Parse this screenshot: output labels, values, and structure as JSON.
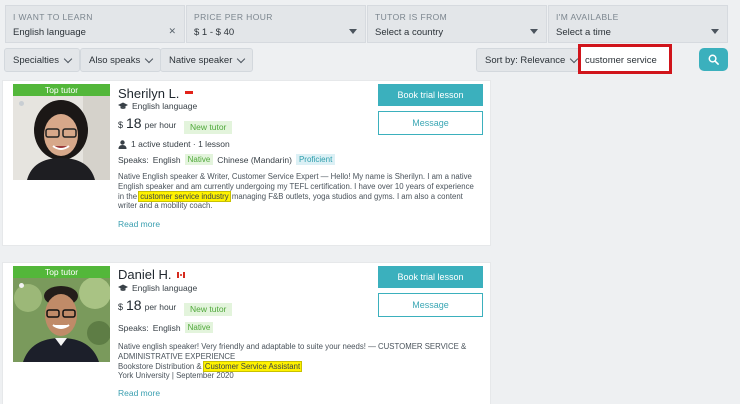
{
  "filters": {
    "learn": {
      "label": "I WANT TO LEARN",
      "value": "English language"
    },
    "price": {
      "label": "PRICE PER HOUR",
      "value": "$ 1 - $ 40"
    },
    "country": {
      "label": "TUTOR IS FROM",
      "value": "Select a country"
    },
    "available": {
      "label": "I'M AVAILABLE",
      "value": "Select a time"
    }
  },
  "chips": {
    "specialties": "Specialties",
    "also_speaks": "Also speaks",
    "native_speaker": "Native speaker"
  },
  "sort": {
    "label": "Sort by: Relevance"
  },
  "search": {
    "value": "customer service"
  },
  "colors": {
    "accent": "#3bb0bd",
    "top_tutor": "#53b73a",
    "highlight_border": "#d0141b",
    "highlight": "#fff200"
  },
  "tutors": [
    {
      "badge": "Top tutor",
      "name": "Sherilyn L.",
      "subject": "English language",
      "currency": "$",
      "price": "18",
      "per": "per hour",
      "new_tag": "New tutor",
      "activity": "1 active student · 1 lesson",
      "speaks_label": "Speaks:",
      "speaks_1": "English",
      "speaks_1_level": "Native",
      "speaks_2": "Chinese (Mandarin)",
      "speaks_2_level": "Proficient",
      "desc_a": "Native English speaker & Writer, Customer Service Expert — Hello! My name is Sherilyn. I am a native English speaker and am currently undergoing my TEFL certification. I have over 10 years of experience in the",
      "desc_hl": "customer service industry",
      "desc_b": "managing F&B outlets, yoga studios and gyms. I am also a content writer and a mobility coach.",
      "read_more": "Read more",
      "trial": "Book trial lesson",
      "message": "Message"
    },
    {
      "badge": "Top tutor",
      "name": "Daniel H.",
      "subject": "English language",
      "currency": "$",
      "price": "18",
      "per": "per hour",
      "new_tag": "New tutor",
      "speaks_label": "Speaks:",
      "speaks_1": "English",
      "speaks_1_level": "Native",
      "desc_a": "Native english speaker! Very friendly and adaptable to suite your needs! — CUSTOMER SERVICE & ADMINISTRATIVE EXPERIENCE",
      "desc_b1": "Bookstore Distribution &",
      "desc_hl": "Customer Service Assistant",
      "desc_c": "York University | September 2020",
      "read_more": "Read more",
      "trial": "Book trial lesson",
      "message": "Message"
    }
  ]
}
